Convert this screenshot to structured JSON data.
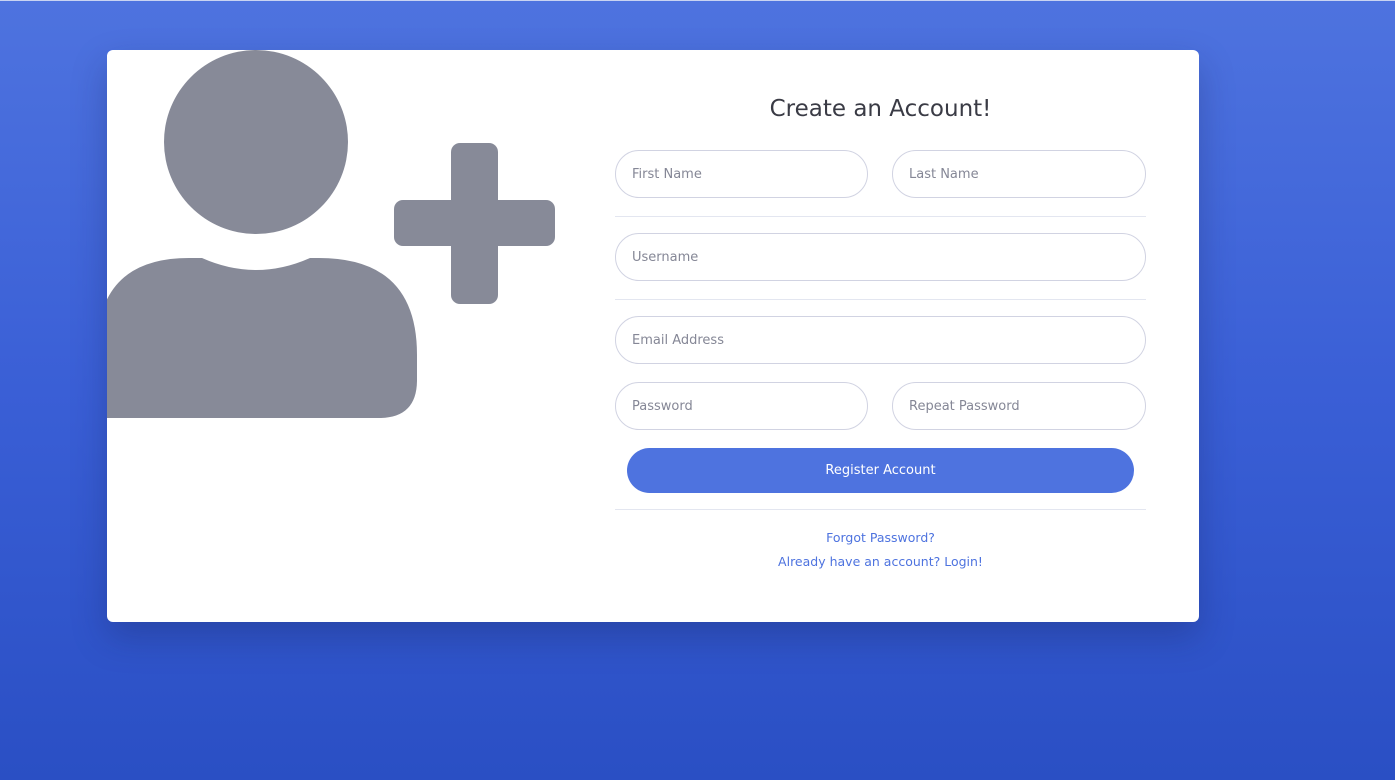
{
  "form": {
    "title": "Create an Account!",
    "first_name_placeholder": "First Name",
    "last_name_placeholder": "Last Name",
    "username_placeholder": "Username",
    "email_placeholder": "Email Address",
    "password_placeholder": "Password",
    "repeat_password_placeholder": "Repeat Password",
    "register_label": "Register Account",
    "forgot_password_link": "Forgot Password?",
    "login_link": "Already have an account? Login!"
  },
  "illustration": {
    "icon": "user-plus-icon",
    "color": "#878a98"
  },
  "colors": {
    "primary": "#4e73df",
    "background_top": "#4e73df",
    "background_bottom": "#2a4fc4",
    "card": "#ffffff"
  }
}
